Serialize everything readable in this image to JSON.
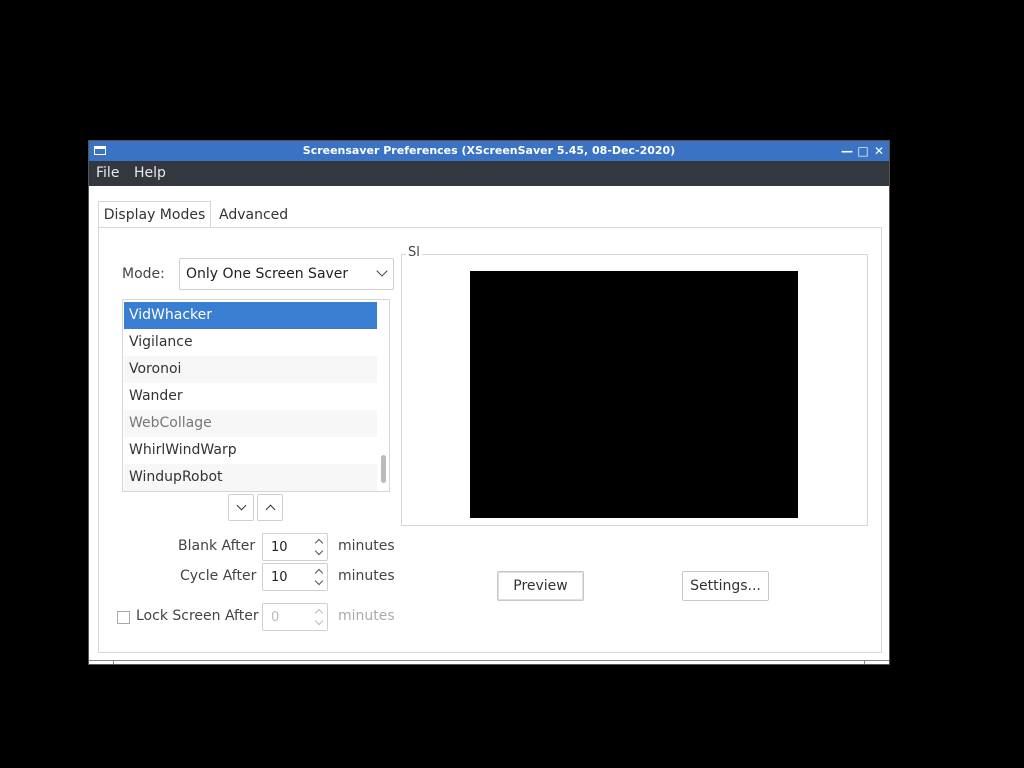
{
  "window": {
    "title": "Screensaver Preferences  (XScreenSaver 5.45, 08-Dec-2020)",
    "controls": {
      "minimize": "—",
      "maximize": "□",
      "close": "✕"
    }
  },
  "menubar": {
    "file": "File",
    "help": "Help"
  },
  "tabs": [
    {
      "label": "Display Modes",
      "active": true
    },
    {
      "label": "Advanced",
      "active": false
    }
  ],
  "mode": {
    "label": "Mode:",
    "value": "Only One Screen Saver"
  },
  "screensaver_list": {
    "items": [
      "VidWhacker",
      "Vigilance",
      "Voronoi",
      "Wander",
      "WebCollage",
      "WhirlWindWarp",
      "WindupRobot"
    ],
    "selected": "VidWhacker"
  },
  "blank_after": {
    "label": "Blank After",
    "value": "10",
    "unit": "minutes"
  },
  "cycle_after": {
    "label": "Cycle After",
    "value": "10",
    "unit": "minutes"
  },
  "lock_screen": {
    "label": "Lock Screen After",
    "value": "0",
    "unit": "minutes",
    "checked": false
  },
  "preview_frame": {
    "label": "Sl"
  },
  "buttons": {
    "preview": "Preview",
    "settings": "Settings..."
  },
  "colors": {
    "titlebar": "#3a72c4",
    "menubar": "#333740",
    "selection": "#3a7ed2"
  }
}
